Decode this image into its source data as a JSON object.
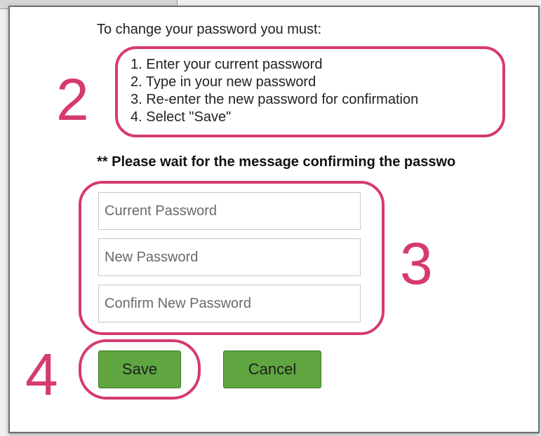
{
  "instructions": {
    "intro": "To change your password you must:",
    "steps": [
      "1. Enter your current password",
      "2. Type in your new password",
      "3. Re-enter the new password for confirmation",
      "4. Select \"Save\""
    ],
    "wait_note": "** Please wait for the message confirming the passwo"
  },
  "form": {
    "current_password": {
      "placeholder": "Current Password",
      "value": ""
    },
    "new_password": {
      "placeholder": "New Password",
      "value": ""
    },
    "confirm_password": {
      "placeholder": "Confirm New Password",
      "value": ""
    },
    "save_label": "Save",
    "cancel_label": "Cancel"
  },
  "annotations": {
    "step_2_number": "2",
    "step_3_number": "3",
    "step_4_number": "4",
    "highlight_color": "#d63a6f"
  },
  "colors": {
    "button_green": "#5fa641",
    "panel_border": "#6f6f6f"
  }
}
